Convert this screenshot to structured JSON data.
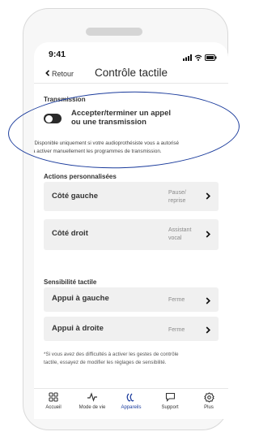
{
  "status": {
    "time": "9:41"
  },
  "nav": {
    "back_label": "Retour",
    "title": "Contrôle tactile"
  },
  "transmission": {
    "section_label": "Transmission",
    "toggle_label_line1": "Accepter/terminer un appel",
    "toggle_label_line2": "ou une transmission",
    "toggle_on": false,
    "note_line1": "*Disponible uniquement si votre audioprothésiste vous a autorisé",
    "note_line2": "à activer manuellement les programmes de transmission."
  },
  "custom_actions": {
    "section_label": "Actions personnalisées",
    "items": [
      {
        "title": "Côté gauche",
        "value_line1": "Pause/",
        "value_line2": "reprise"
      },
      {
        "title": "Côté droit",
        "value_line1": "Assistant",
        "value_line2": "vocal"
      }
    ]
  },
  "sensitivity": {
    "section_label": "Sensibilité tactile",
    "items": [
      {
        "title": "Appui à gauche",
        "value": "Ferme"
      },
      {
        "title": "Appui à droite",
        "value": "Ferme"
      }
    ],
    "note_line1": "*Si vous avez des difficultés à activer les gestes de contrôle",
    "note_line2": "tactile, essayez de modifier les réglages de sensibilité."
  },
  "tabs": [
    {
      "label": "Accueil",
      "icon": "grid-icon",
      "active": false
    },
    {
      "label": "Mode de vie",
      "icon": "activity-icon",
      "active": false
    },
    {
      "label": "Appareils",
      "icon": "hearing-aid-icon",
      "active": true
    },
    {
      "label": "Support",
      "icon": "chat-icon",
      "active": false
    },
    {
      "label": "Plus",
      "icon": "settings-icon",
      "active": false
    }
  ],
  "colors": {
    "accent": "#1a3b9c",
    "annotation": "#1a3b9c",
    "card_bg": "#f0f0f0"
  }
}
